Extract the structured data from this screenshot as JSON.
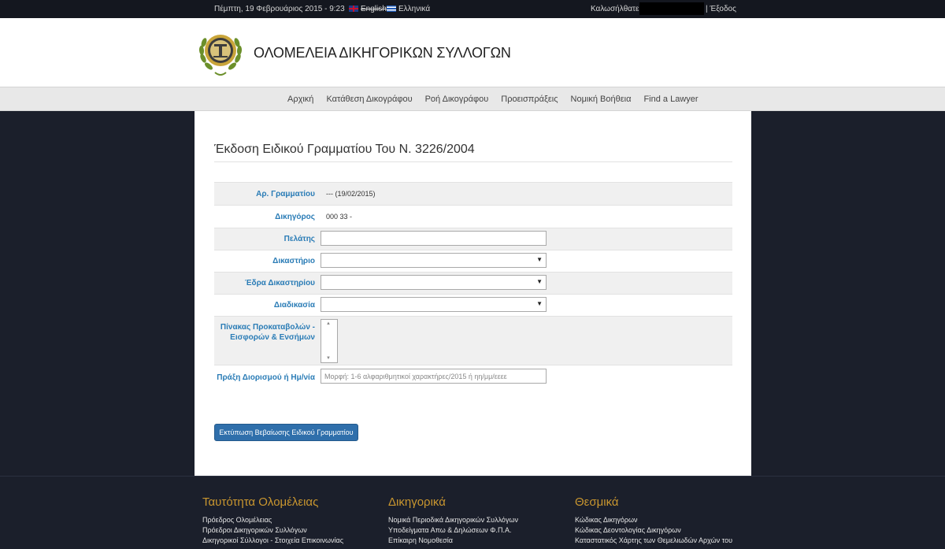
{
  "topbar": {
    "date": "Πέμπτη, 19 Φεβρουάριος 2015 - 9:23",
    "lang_en": "English",
    "lang_gr": "Ελληνικά",
    "welcome": "Καλωσήλθατε",
    "logout": "| Έξοδος"
  },
  "header": {
    "site_title": "ΟΛΟΜΕΛΕΙΑ ΔΙΚΗΓΟΡΙΚΩΝ ΣΥΛΛΟΓΩΝ"
  },
  "nav": {
    "items": [
      "Αρχική",
      "Κατάθεση Δικογράφου",
      "Ροή Δικογράφου",
      "Προεισπράξεις",
      "Νομική Βοήθεια",
      "Find a Lawyer"
    ]
  },
  "main": {
    "title": "Έκδοση Ειδικού Γραμματίου Του Ν. 3226/2004",
    "fields": {
      "number_label": "Αρ. Γραμματίου",
      "number_value": "---   (19/02/2015)",
      "lawyer_label": "Δικηγόρος",
      "lawyer_value": "000  33 -",
      "client_label": "Πελάτης",
      "client_value": "",
      "court_label": "Δικαστήριο",
      "court_selected": "",
      "seat_label": "Έδρα Δικαστηρίου",
      "seat_selected": "",
      "procedure_label": "Διαδικασία",
      "procedure_selected": "",
      "table_label": "Πίνακας Προκαταβολών - Εισφορών & Ενσήμων",
      "appointment_label": "Πράξη Διορισμού ή Ημ/νία",
      "appointment_placeholder": "Μορφή: 1-6 αλφαριθμητικοί χαρακτήρες/2015 ή ηη/μμ/εεεε"
    },
    "print_button": "Εκτύπωση Βεβαίωσης Ειδικού Γραμματίου"
  },
  "footer": {
    "col1": {
      "title": "Ταυτότητα Ολομέλειας",
      "links": [
        "Πρόεδρος Ολομέλειας",
        "Πρόεδροι Δικηγορικών Συλλόγων",
        "Δικηγορικοί Σύλλογοι - Στοιχεία Επικοινωνίας"
      ]
    },
    "col2": {
      "title": "Δικηγορικά",
      "links": [
        "Νομικά Περιοδικά Δικηγορικών Συλλόγων",
        "Υποδείγματα Απω & Δηλώσεων Φ.Π.Α.",
        "Επίκαιρη Νομοθεσία"
      ]
    },
    "col3": {
      "title": "Θεσμικά",
      "links": [
        "Κώδικας Δικηγόρων",
        "Κώδικας Δεοντολογίας Δικηγόρων",
        "Καταστατικός Χάρτης των Θεμελιωδών Αρχών του"
      ]
    }
  },
  "colors": {
    "accent_link": "#2a7cb6",
    "button": "#2f6fab",
    "footer_heading": "#c9962f",
    "dark_background": "#1b1f2b"
  },
  "icons": [
    "greek-lawyers-emblem-icon",
    "uk-flag-icon",
    "greek-flag-icon",
    "dropdown-arrow-icon",
    "scroll-up-icon",
    "scroll-down-icon"
  ]
}
